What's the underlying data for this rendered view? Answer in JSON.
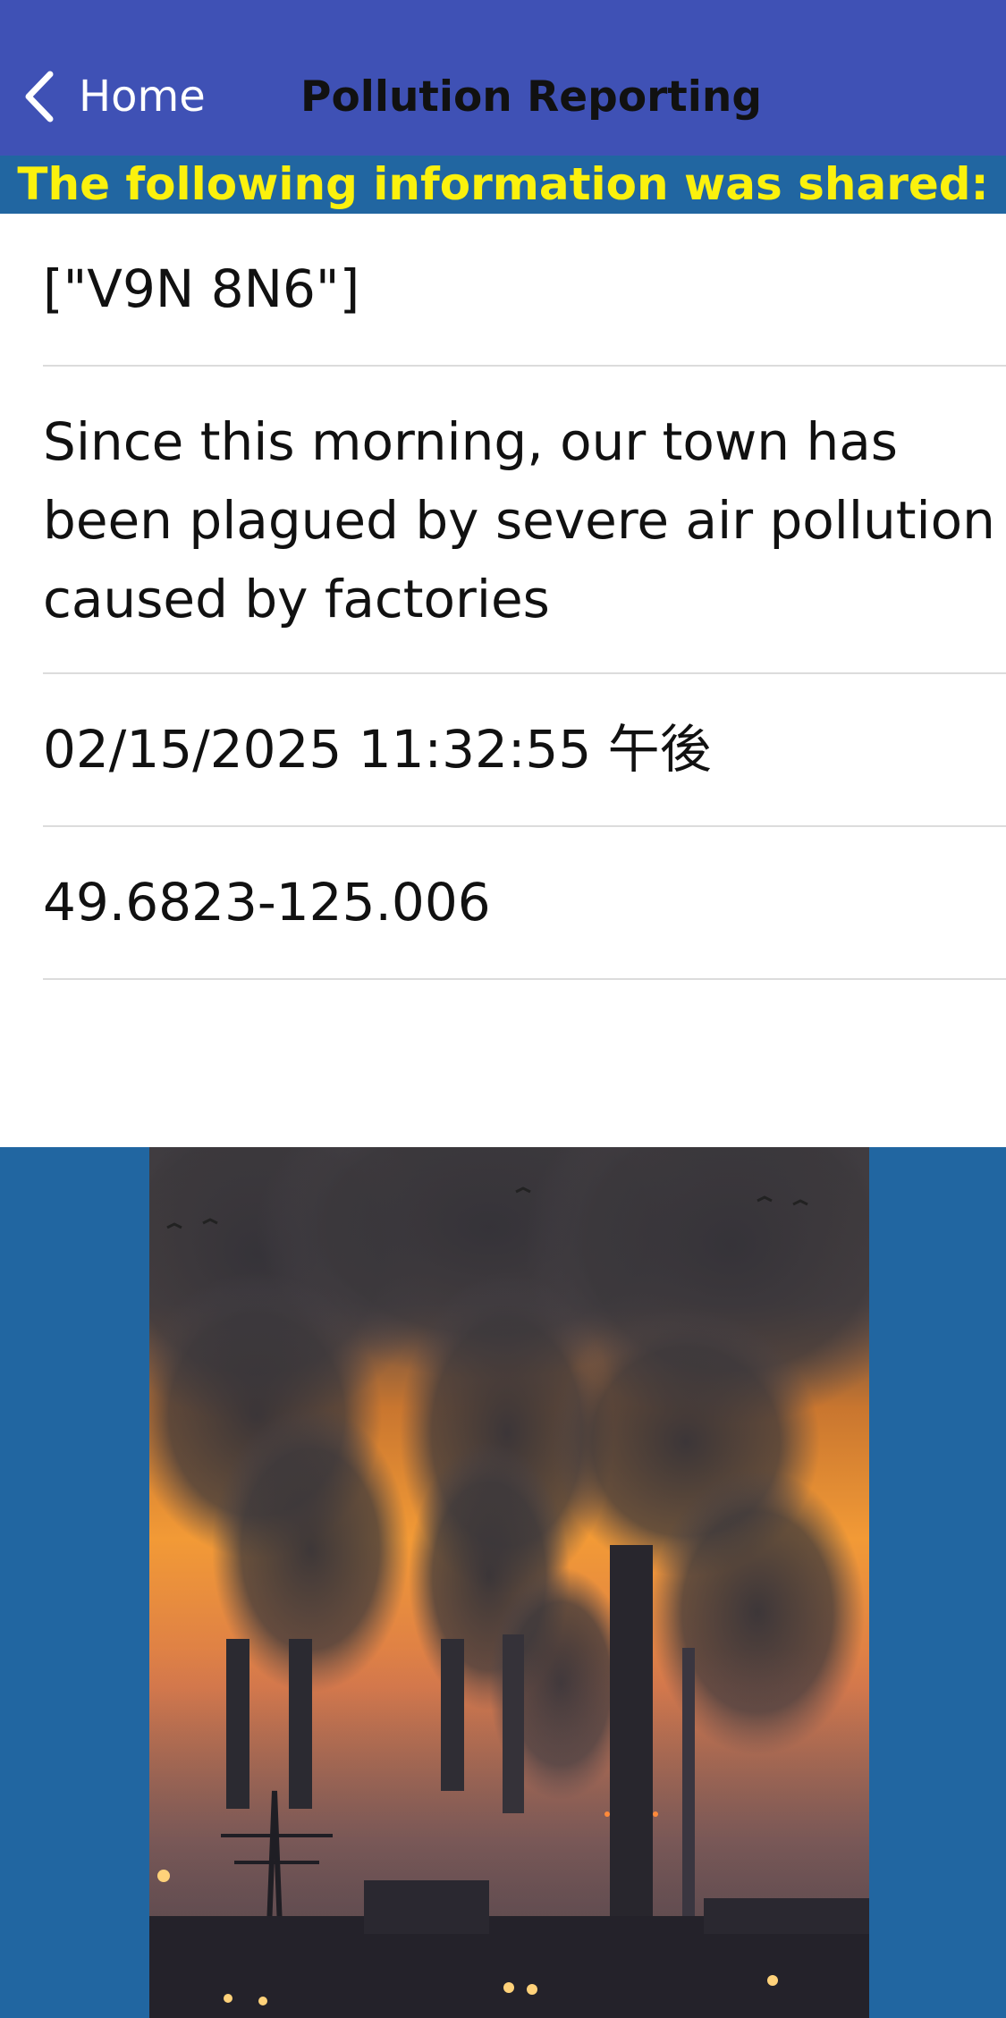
{
  "navbar": {
    "back_label": "Home",
    "title": "Pollution Reporting",
    "background_color": "#3f51b5",
    "back_icon": "chevron-left-icon"
  },
  "banner": {
    "text": "The following information was shared:",
    "background_color": "#2166a1",
    "text_color": "#fbf10d"
  },
  "report": {
    "postal_codes": "[\"V9N 8N6\"]",
    "description": "Since this morning, our town has been plagued by severe air pollution caused by factories",
    "timestamp": "02/15/2025 11:32:55 午後",
    "coordinates": "49.6823-125.006"
  },
  "photo": {
    "subject": "factory smokestacks emitting smoke at dusk"
  }
}
